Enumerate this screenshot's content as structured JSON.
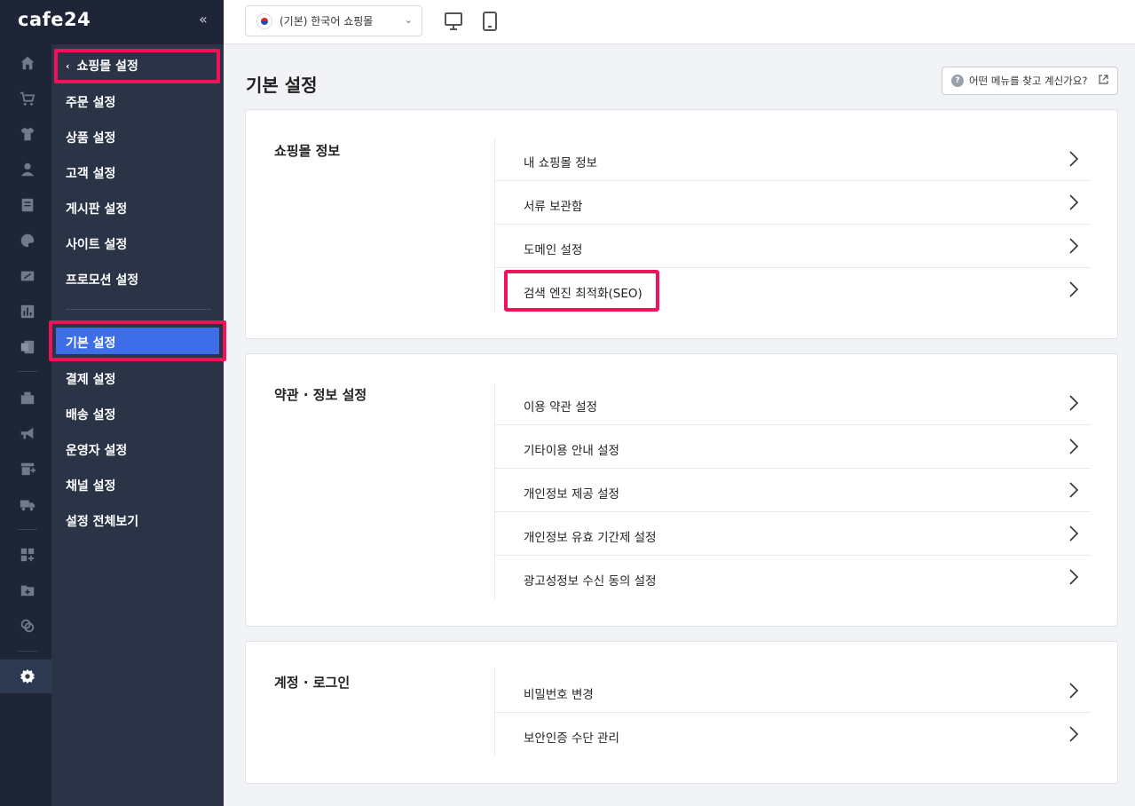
{
  "brand": {
    "logo": "cafe24",
    "collapse_icon": "double-chevron-left-icon"
  },
  "topbar": {
    "store_select": "(기본) 한국어 쇼핑몰",
    "devices": [
      "desktop-icon",
      "mobile-icon"
    ]
  },
  "rail": {
    "icons": [
      "home-icon",
      "cart-icon",
      "shirt-icon",
      "user-icon",
      "board-icon",
      "palette-icon",
      "promotion-icon",
      "chart-icon",
      "excel-icon",
      "store-icon",
      "megaphone-icon",
      "add-store-icon",
      "truck-icon",
      "apps-icon",
      "folder-add-icon",
      "link-icon",
      "gear-icon"
    ]
  },
  "sidebar": {
    "back_label": "쇼핑몰 설정",
    "group1": [
      "주문 설정",
      "상품 설정",
      "고객 설정",
      "게시판 설정",
      "사이트 설정",
      "프로모션 설정"
    ],
    "group2": [
      "기본 설정",
      "결제 설정",
      "배송 설정",
      "운영자 설정",
      "채널 설정",
      "설정 전체보기"
    ]
  },
  "page": {
    "title": "기본 설정",
    "help": "어떤 메뉴를 찾고 계신가요?"
  },
  "sections": [
    {
      "title": "쇼핑몰 정보",
      "items": [
        "내 쇼핑몰 정보",
        "서류 보관함",
        "도메인 설정",
        "검색 엔진 최적화(SEO)"
      ]
    },
    {
      "title": "약관 · 정보 설정",
      "items": [
        "이용 약관 설정",
        "기타이용 안내 설정",
        "개인정보 제공 설정",
        "개인정보 유효 기간제 설정",
        "광고성정보 수신 동의 설정"
      ]
    },
    {
      "title": "계정 · 로그인",
      "items": [
        "비밀번호 변경",
        "보안인증 수단 관리"
      ]
    }
  ],
  "colors": {
    "highlight": "#f0135a",
    "active": "#3d6ee8",
    "sidebar": "#2b3447",
    "rail": "#1d2536"
  }
}
